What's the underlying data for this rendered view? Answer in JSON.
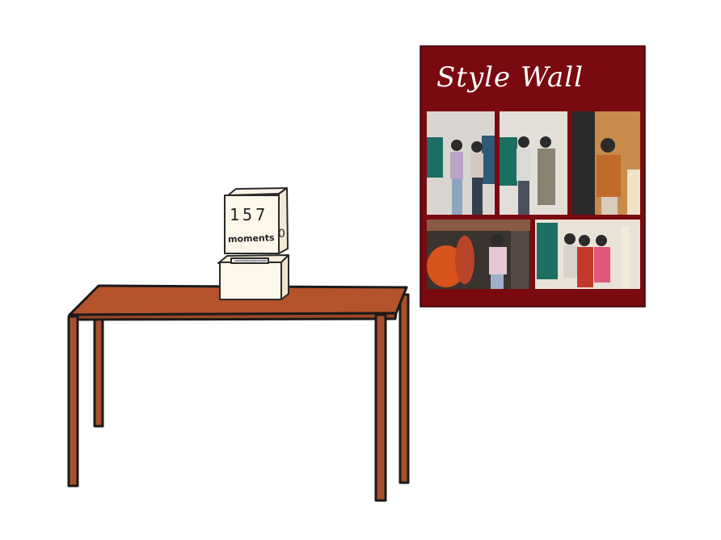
{
  "poster": {
    "title": "Style Wall",
    "background_color": "#7a0a10",
    "photo_count": 5
  },
  "counter_box": {
    "count": "157",
    "label": "moments",
    "side_mark": "0"
  },
  "table": {
    "color": "#b5532c"
  }
}
